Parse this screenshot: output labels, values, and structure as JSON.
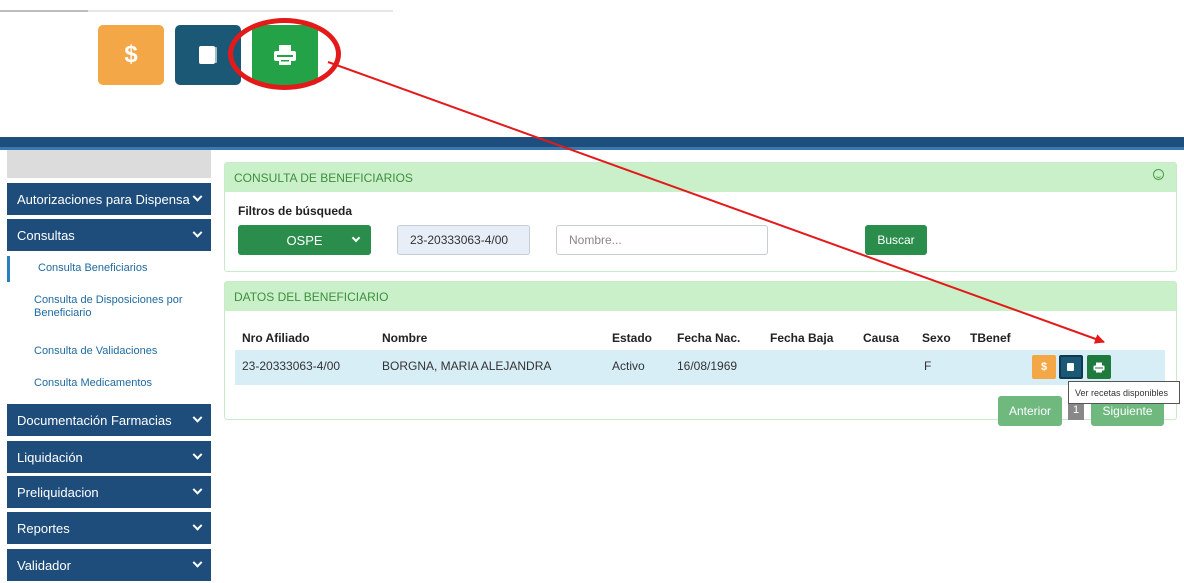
{
  "zoom": {
    "dollar_glyph": "$",
    "icons": [
      "dollar-icon",
      "book-icon",
      "printer-icon"
    ]
  },
  "sidebar": {
    "items": [
      {
        "label": "Autorizaciones para Dispensa"
      },
      {
        "label": "Consultas"
      },
      {
        "label": "Documentación Farmacias"
      },
      {
        "label": "Liquidación"
      },
      {
        "label": "Preliquidacion"
      },
      {
        "label": "Reportes"
      },
      {
        "label": "Validador"
      }
    ],
    "subitems": [
      {
        "label": "Consulta Beneficiarios"
      },
      {
        "label": "Consulta de Disposiciones por Beneficiario"
      },
      {
        "label": "Consulta de Validaciones"
      },
      {
        "label": "Consulta Medicamentos"
      }
    ]
  },
  "search": {
    "panel_title": "CONSULTA DE BENEFICIARIOS",
    "filters_label": "Filtros de búsqueda",
    "obra_social": "OSPE",
    "doc_value": "23-20333063-4/00",
    "name_placeholder": "Nombre...",
    "search_button": "Buscar"
  },
  "results": {
    "panel_title": "DATOS DEL BENEFICIARIO",
    "columns": [
      "Nro Afiliado",
      "Nombre",
      "Estado",
      "Fecha Nac.",
      "Fecha Baja",
      "Causa",
      "Sexo",
      "TBenef"
    ],
    "row": {
      "nro": "23-20333063-4/00",
      "nombre": "BORGNA, MARIA ALEJANDRA",
      "estado": "Activo",
      "fecha_nac": "16/08/1969",
      "fecha_baja": "",
      "causa": "",
      "sexo": "F",
      "tbenef": ""
    },
    "action_dollar": "$",
    "tooltip": "Ver recetas disponibles",
    "prev_button": "Anterior",
    "page": "1",
    "next_button": "Siguiente"
  },
  "colors": {
    "dollar": "#f3a746",
    "book": "#1b5875",
    "print": "#24a247",
    "annotation": "#e41a1a",
    "nav": "#1e4d7c"
  }
}
